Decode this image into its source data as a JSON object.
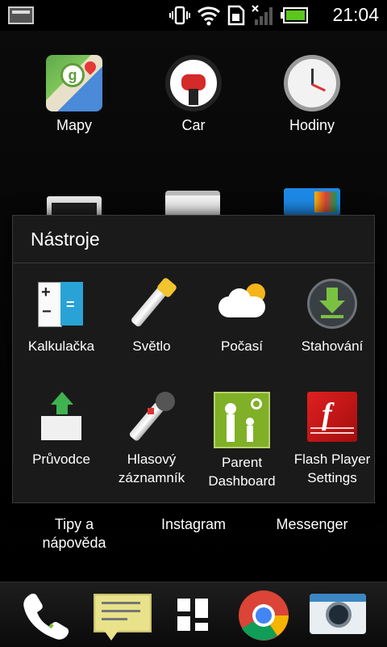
{
  "status": {
    "time": "21:04",
    "icons": [
      "notification-icon",
      "vibrate-icon",
      "wifi-icon",
      "sim-icon",
      "no-signal-icon",
      "battery-icon"
    ]
  },
  "home": {
    "row1": [
      {
        "label": "Mapy",
        "icon": "maps-icon"
      },
      {
        "label": "Car",
        "icon": "car-steering-icon"
      },
      {
        "label": "Hodiny",
        "icon": "clock-icon"
      }
    ],
    "row3": [
      {
        "label": "Tipy a\nnápověda",
        "label_line1": "Tipy a",
        "label_line2": "nápověda"
      },
      {
        "label": "Instagram"
      },
      {
        "label": "Messenger"
      }
    ]
  },
  "folder": {
    "title": "Nástroje",
    "apps": [
      {
        "label1": "Kalkulačka",
        "label2": "",
        "icon": "calculator-icon"
      },
      {
        "label1": "Světlo",
        "label2": "",
        "icon": "flashlight-icon"
      },
      {
        "label1": "Počasí",
        "label2": "",
        "icon": "weather-icon"
      },
      {
        "label1": "Stahování",
        "label2": "",
        "icon": "download-icon"
      },
      {
        "label1": "Průvodce",
        "label2": "",
        "icon": "transfer-icon"
      },
      {
        "label1": "Hlasový",
        "label2": "záznamník",
        "icon": "microphone-icon"
      },
      {
        "label1": "Parent",
        "label2": "Dashboard",
        "icon": "parent-dashboard-icon"
      },
      {
        "label1": "Flash Player",
        "label2": "Settings",
        "icon": "flash-icon"
      }
    ]
  },
  "dock": [
    "phone-icon",
    "messages-icon",
    "apps-grid-icon",
    "chrome-icon",
    "camera-icon"
  ],
  "colors": {
    "background": "#000000",
    "folder_bg": "#1a1a1a",
    "battery_green": "#5cc51e"
  }
}
